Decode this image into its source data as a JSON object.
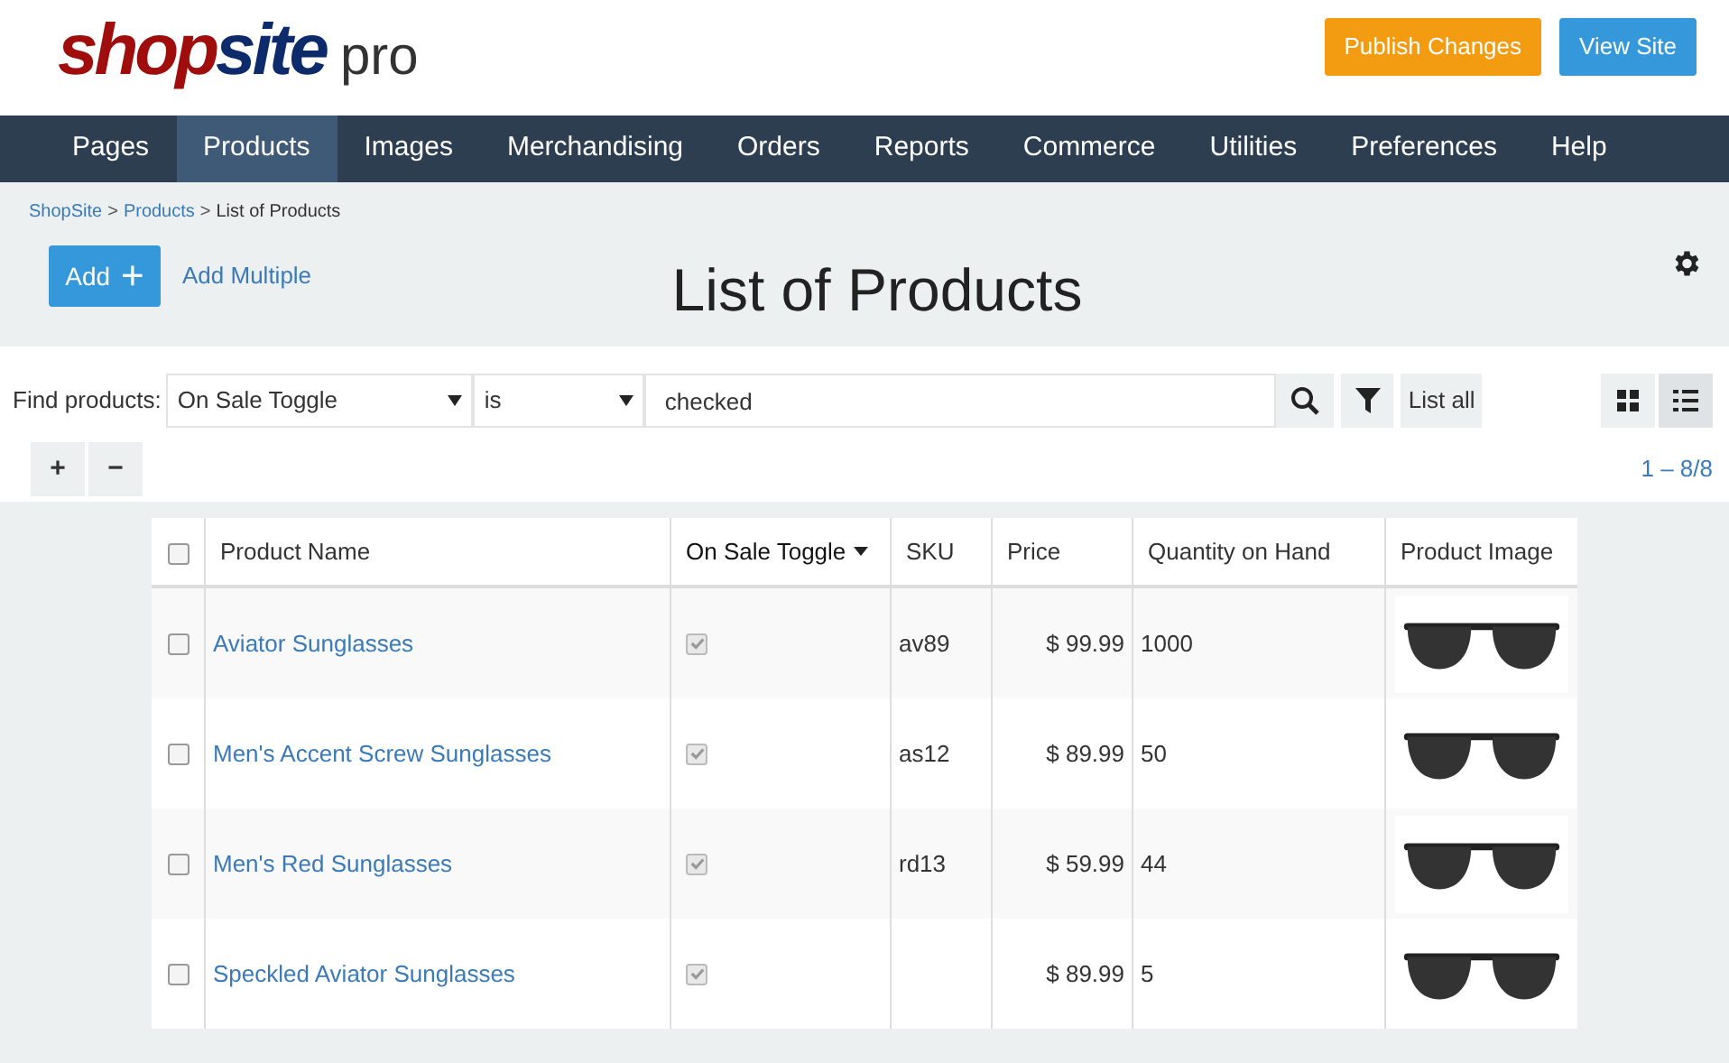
{
  "logo": {
    "part_1": "shop",
    "part_2": "site",
    "suffix": "pro"
  },
  "header_buttons": [
    {
      "label": "Publish Changes",
      "kind": "warning"
    },
    {
      "label": "View Site",
      "kind": "primary"
    }
  ],
  "nav": [
    {
      "label": "Pages",
      "selected": false
    },
    {
      "label": "Products",
      "selected": true
    },
    {
      "label": "Images",
      "selected": false
    },
    {
      "label": "Merchandising",
      "selected": false
    },
    {
      "label": "Orders",
      "selected": false
    },
    {
      "label": "Reports",
      "selected": false
    },
    {
      "label": "Commerce",
      "selected": false
    },
    {
      "label": "Utilities",
      "selected": false
    },
    {
      "label": "Preferences",
      "selected": false
    },
    {
      "label": "Help",
      "selected": false
    }
  ],
  "breadcrumbs": [
    {
      "label": "ShopSite",
      "link": true
    },
    {
      "label": "Products",
      "link": true
    },
    {
      "label": "List of Products",
      "link": false
    }
  ],
  "breadcrumb_separator": ">",
  "add_button": {
    "label": "Add",
    "icon": "+"
  },
  "add_multiple": "Add Multiple",
  "page_title": "List of Products",
  "search": {
    "label": "Find products:",
    "field": "On Sale Toggle",
    "operator": "is",
    "value": "checked",
    "list_all": "List all"
  },
  "view_toggle": [
    {
      "kind": "grid",
      "selected": false
    },
    {
      "kind": "list",
      "selected": true
    }
  ],
  "expand_buttons": [
    "+",
    "−"
  ],
  "pagination": "1 – 8/8",
  "table": {
    "all_selected": false,
    "columns": [
      {
        "label": "Product Name",
        "sorted": false
      },
      {
        "label": "On Sale Toggle",
        "sorted": true
      },
      {
        "label": "SKU",
        "sorted": false
      },
      {
        "label": "Price",
        "sorted": false
      },
      {
        "label": "Quantity on Hand",
        "sorted": false
      },
      {
        "label": "Product Image",
        "sorted": false
      }
    ],
    "rows": [
      {
        "selected": false,
        "name": "Aviator Sunglasses",
        "on_sale": true,
        "sku": "av89",
        "price": "$ 99.99",
        "quantity": "1000"
      },
      {
        "selected": false,
        "name": "Men's Accent Screw Sunglasses",
        "on_sale": true,
        "sku": "as12",
        "price": "$ 89.99",
        "quantity": "50"
      },
      {
        "selected": false,
        "name": "Men's Red Sunglasses",
        "on_sale": true,
        "sku": "rd13",
        "price": "$ 59.99",
        "quantity": "44"
      },
      {
        "selected": false,
        "name": "Speckled Aviator Sunglasses",
        "on_sale": true,
        "sku": "",
        "price": "$ 89.99",
        "quantity": "5"
      }
    ]
  }
}
